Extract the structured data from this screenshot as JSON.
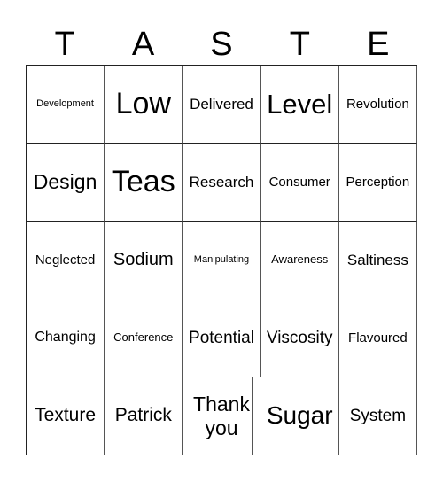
{
  "card": {
    "title_letters": [
      "T",
      "A",
      "S",
      "T",
      "E"
    ],
    "rows": [
      [
        "Development",
        "Low",
        "Delivered",
        "Level",
        "Revolution"
      ],
      [
        "Design",
        "Teas",
        "Research",
        "Consumer",
        "Perception"
      ],
      [
        "Neglected",
        "Sodium",
        "Manipulating",
        "Awareness",
        "Saltiness"
      ],
      [
        "Changing",
        "Conference",
        "Potential",
        "Viscosity",
        "Flavoured"
      ],
      [
        "Texture",
        "Patrick",
        "Thank you",
        "Sugar",
        "System"
      ]
    ]
  }
}
